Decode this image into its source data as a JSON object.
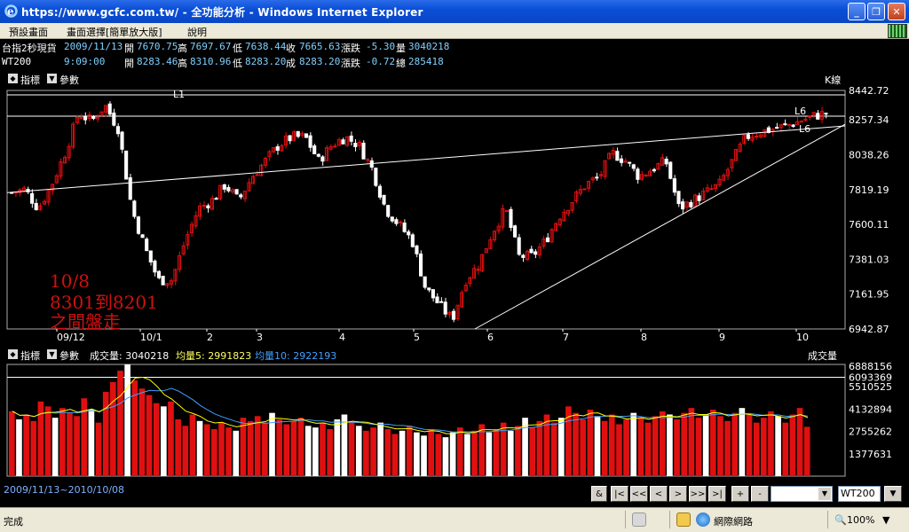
{
  "window": {
    "title": "https://www.gcfc.com.tw/ - 全功能分析 - Windows Internet Explorer",
    "min_label": "_",
    "max_label": "❐",
    "close_label": "✕"
  },
  "menu": [
    "預設畫面",
    "畫面選擇[簡單放大版]",
    "說明"
  ],
  "row1": {
    "name": "台指2秒現貨",
    "date": "2009/11/13",
    "open_label": "開",
    "open": "7670.75",
    "high_label": "高",
    "high": "7697.67",
    "low_label": "低",
    "low": "7638.44",
    "close_label": "收",
    "close": "7665.63",
    "change_label": "漲跌",
    "change": "-5.30",
    "volume_label": "量",
    "volume": "3040218"
  },
  "row2": {
    "name": "WT200",
    "time": "9:09:00",
    "open_label": "開",
    "open": "8283.46",
    "high_label": "高",
    "high": "8310.96",
    "low_label": "低",
    "low": "8283.20",
    "deal_label": "成",
    "deal": "8283.20",
    "change_label": "漲跌",
    "change": "-0.72",
    "total_label": "總",
    "total": "285418"
  },
  "price_panel": {
    "indicator_label": "指標",
    "param_label": "參數",
    "chart_type_label": "K線"
  },
  "volume_panel": {
    "indicator_label": "指標",
    "param_label": "參數",
    "vol_text": "成交量: 3040218",
    "ma5_text": "均量5: 2991823",
    "ma10_text": "均量10: 2922193",
    "right_label": "成交量"
  },
  "range_text": "2009/11/13~2010/10/08",
  "nav_buttons": [
    "&",
    "|<",
    "<<",
    "<",
    ">",
    ">>",
    ">|",
    "+",
    "-"
  ],
  "code_value": "WT200",
  "status": {
    "done": "完成",
    "zone": "網際網路",
    "zoom": "100%"
  },
  "colors": {
    "up": "#e01010",
    "down": "#ffffff",
    "grid": "#ffffff",
    "ma5": "#ffff00",
    "ma10": "#40a0ff",
    "annotation": "#d01010"
  },
  "chart_data": [
    {
      "type": "candlestick",
      "y_ticks": [
        "8442.72",
        "8257.34",
        "8038.26",
        "7819.19",
        "7600.11",
        "7381.03",
        "7161.95",
        "6942.87"
      ],
      "ylim": [
        6942.87,
        8442.72
      ],
      "x_labels": [
        "09/12",
        "10/1",
        "2",
        "3",
        "4",
        "5",
        "6",
        "7",
        "8",
        "9",
        "10"
      ],
      "labels": [
        "L1",
        "L6",
        "L6"
      ],
      "annotation": [
        "10/8",
        "8301到8201",
        "之間盤走"
      ],
      "approx_close_path": [
        7800,
        7820,
        7700,
        7850,
        8050,
        8300,
        8250,
        8350,
        8200,
        7700,
        7450,
        7250,
        7250,
        7500,
        7700,
        7750,
        7850,
        7750,
        7900,
        8000,
        8100,
        8150,
        8150,
        8000,
        8100,
        8150,
        8100,
        7950,
        7700,
        7600,
        7500,
        7200,
        7100,
        7000,
        7250,
        7350,
        7550,
        7700,
        7400,
        7400,
        7500,
        7650,
        7750,
        7850,
        7900,
        8050,
        8000,
        7900,
        7950,
        8000,
        7700,
        7750,
        7800,
        7850,
        8000,
        8150,
        8180,
        8200,
        8220,
        8250,
        8280,
        8300
      ]
    },
    {
      "type": "bar",
      "y_ticks": [
        "6888156",
        "6093369",
        "5510525",
        "4132894",
        "2755262",
        "1377631"
      ],
      "ylim": [
        0,
        6888156
      ],
      "series": [
        {
          "name": "成交量",
          "values": [
            4000000,
            3500000,
            3800000,
            3400000,
            4600000,
            4300000,
            3600000,
            4200000,
            3900000,
            3700000,
            4800000,
            4100000,
            3300000,
            5200000,
            5800000,
            6500000,
            6888156,
            5900000,
            5400000,
            5000000,
            4500000,
            4300000,
            4600000,
            3500000,
            3100000,
            3800000,
            3400000,
            3200000,
            2900000,
            3300000,
            3000000,
            2800000,
            3600000,
            3400000,
            3700000,
            3300000,
            3900000,
            3500000,
            3200000,
            3400000,
            3600000,
            3100000,
            3000000,
            3300000,
            2900000,
            3500000,
            3800000,
            3400000,
            3100000,
            2800000,
            3000000,
            3300000,
            2900000,
            2600000,
            2800000,
            3100000,
            2700000,
            2500000,
            2900000,
            2600000,
            2400000,
            2700000,
            3000000,
            2600000,
            2800000,
            3200000,
            2700000,
            2900000,
            3300000,
            2800000,
            3100000,
            3600000,
            3000000,
            3400000,
            3800000,
            3300000,
            3600000,
            4300000,
            3900000,
            3500000,
            4100000,
            3700000,
            3400000,
            3800000,
            3200000,
            3500000,
            3900000,
            3600000,
            3300000,
            3700000,
            4000000,
            3800000,
            3500000,
            3900000,
            4200000,
            3600000,
            3800000,
            4100000,
            3700000,
            3400000,
            3900000,
            4200000,
            3800000,
            3300000,
            3600000,
            4000000,
            3700000,
            3300000,
            3800000,
            4200000,
            3040218
          ]
        },
        {
          "name": "均量5",
          "values": []
        },
        {
          "name": "均量10",
          "values": []
        }
      ]
    }
  ]
}
